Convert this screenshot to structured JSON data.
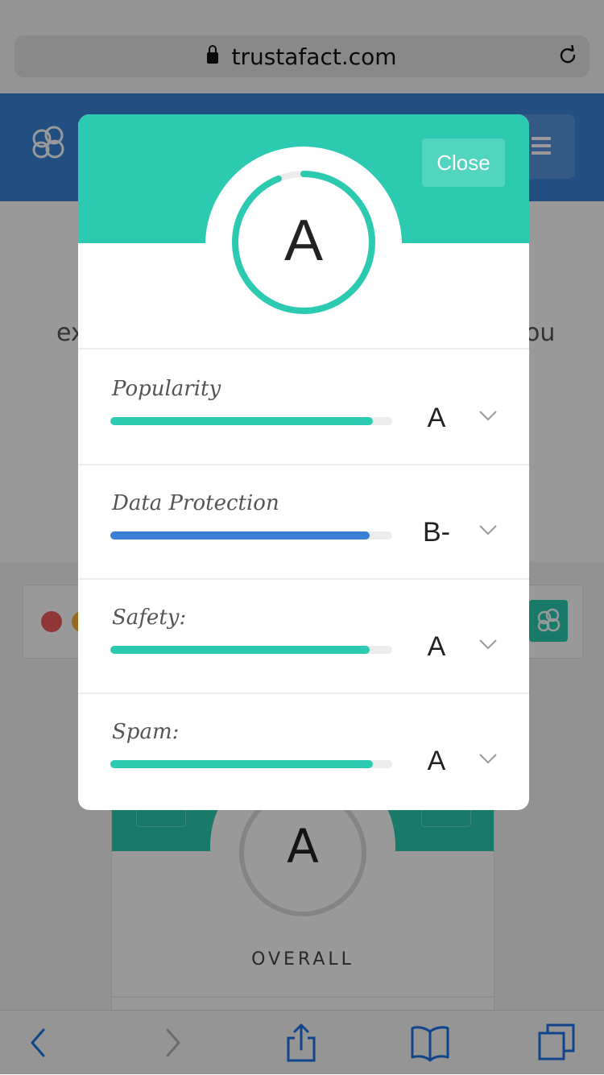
{
  "browser": {
    "url": "trustafact.com"
  },
  "page": {
    "intro_left": "ex",
    "intro_right": "ou",
    "score_card": {
      "grade": "A",
      "label": "OVERALL"
    }
  },
  "modal": {
    "close_label": "Close",
    "overall_grade": "A",
    "overall_progress": 0.94,
    "metrics": [
      {
        "label": "Popularity",
        "grade": "A",
        "score": 0.93,
        "color": "#2ccbb1"
      },
      {
        "label": "Data Protection",
        "grade": "B-",
        "score": 0.92,
        "color": "#3b7fd4"
      },
      {
        "label": "Safety:",
        "grade": "A",
        "score": 0.92,
        "color": "#2ccbb1"
      },
      {
        "label": "Spam:",
        "grade": "A",
        "score": 0.93,
        "color": "#2ccbb1"
      }
    ]
  },
  "toolbar": {
    "icons": [
      "back-icon",
      "forward-icon",
      "share-icon",
      "bookmarks-icon",
      "tabs-icon"
    ]
  },
  "colors": {
    "accent": "#2ccbb1",
    "header_blue": "#3b82d8",
    "data_protection_bar": "#3b7fd4"
  }
}
